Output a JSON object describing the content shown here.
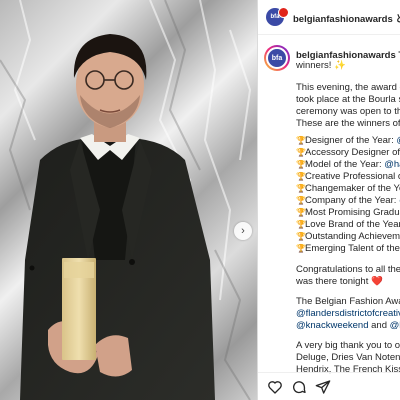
{
  "post": {
    "author": "belgianfashionawards",
    "header_text": "belgianfashionawards と 他",
    "avatar_text": "bfa",
    "caption_title": "belgianfashionawards These",
    "caption_title_cont": "winners! ✨",
    "caption_lines": [
      "This evening, the award cer",
      "took place at the Bourla sch",
      "ceremony was open to the p",
      "These are the winners of th"
    ],
    "awards": [
      {
        "label": "Designer of the Year: ",
        "mention": "@j"
      },
      {
        "label": "Accessory Designer of th",
        "mention": ""
      },
      {
        "label": "Model of the Year: ",
        "mention": "@han"
      },
      {
        "label": "Creative Professional of",
        "mention": ""
      },
      {
        "label": "Changemaker of the Yea",
        "mention": ""
      },
      {
        "label": "Company of the Year: ",
        "mention": "@"
      },
      {
        "label": "Most Promising Graduate",
        "mention": ""
      },
      {
        "label": "Love Brand of the Year: ",
        "mention": "("
      },
      {
        "label": "Outstanding Achievemen",
        "mention": ""
      },
      {
        "label": "Emerging Talent of the Ye",
        "mention": ""
      }
    ],
    "congrats_line1": "Congratulations to all the w",
    "congrats_line2": "was there tonight ❤️",
    "partners_line1": "The Belgian Fashion Awards",
    "partners_mention1": "@flandersdistrictofcreativit",
    "partners_mention2": "@knackweekend",
    "partners_and": " and ",
    "partners_mention3": "@levi",
    "thanks_line1": "A very big thank you to our",
    "thanks_line2": "Deluge, Dries Van Noten, S",
    "thanks_line3": "Hendrix, The French Kiss C"
  },
  "icons": {
    "like": "heart-icon",
    "comment": "comment-icon",
    "share": "share-icon",
    "carousel_next": "chevron-right-icon",
    "award": "trophy-icon"
  },
  "colors": {
    "text": "#262626",
    "mention": "#00376b",
    "avatar_bg": "#3b4aa6",
    "trophy": "#c9a227"
  }
}
